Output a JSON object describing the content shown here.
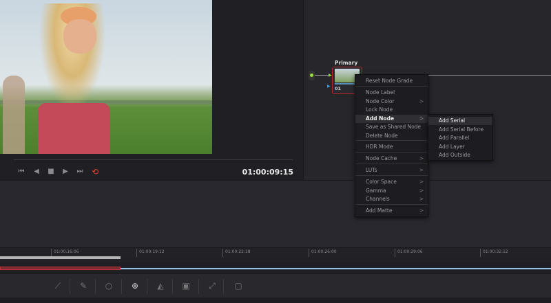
{
  "viewer": {
    "timecode": "01:00:09:15",
    "transport": [
      "skip-back",
      "step-back",
      "stop",
      "play",
      "skip-forward",
      "loop"
    ],
    "loop_color": "#e0452f"
  },
  "node": {
    "label": "Primary",
    "number": "01"
  },
  "context_menu": {
    "items": [
      {
        "label": "Reset Node Grade"
      },
      {
        "label": "Node Label"
      },
      {
        "label": "Node Color",
        "submenu": true
      },
      {
        "label": "Lock Node"
      },
      {
        "label": "Add Node",
        "submenu": true,
        "highlighted": true
      },
      {
        "label": "Save as Shared Node"
      },
      {
        "label": "Delete Node"
      },
      {
        "label": "HDR Mode"
      },
      {
        "label": "Node Cache",
        "submenu": true
      },
      {
        "label": "LUTs",
        "submenu": true
      },
      {
        "label": "Color Space",
        "submenu": true
      },
      {
        "label": "Gamma",
        "submenu": true
      },
      {
        "label": "Channels",
        "submenu": true
      },
      {
        "label": "Add Matte",
        "submenu": true
      }
    ],
    "chevron": ">"
  },
  "submenu": {
    "items": [
      "Add Serial",
      "Add Serial Before",
      "Add Parallel",
      "Add Layer",
      "Add Outside"
    ]
  },
  "timeline": {
    "ticks": [
      "01:00:16:06",
      "01:00:19:12",
      "01:00:22:18",
      "01:00:26:00",
      "01:00:29:06",
      "01:00:32:12"
    ]
  },
  "toolbar": {
    "icons": [
      "curves-icon",
      "picker-icon",
      "window-icon",
      "tracker-icon",
      "blur-icon",
      "key-icon",
      "sizing-icon",
      "3d-icon"
    ]
  }
}
